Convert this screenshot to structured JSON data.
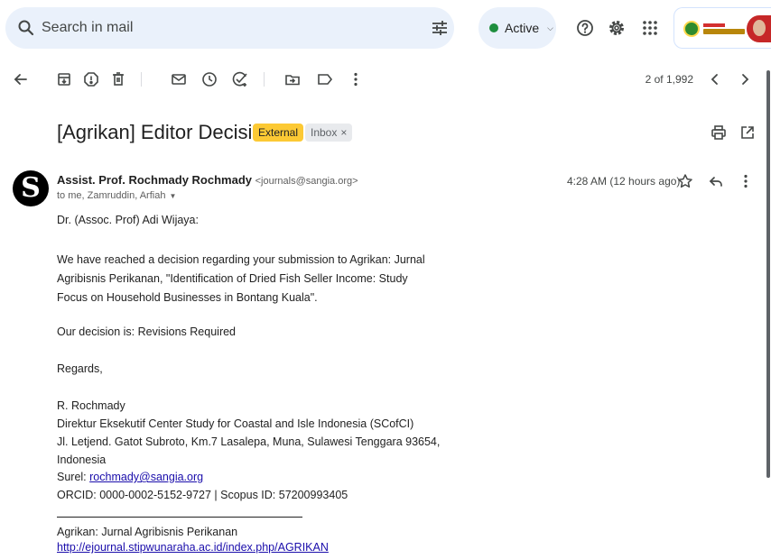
{
  "search": {
    "placeholder": "Search in mail",
    "value": ""
  },
  "status": {
    "label": "Active",
    "color": "#1e8e3e"
  },
  "pager": {
    "text": "2 of 1,992"
  },
  "email": {
    "subject": "[Agrikan] Editor Decision",
    "labels": {
      "external": "External",
      "inbox": "Inbox",
      "inbox_remove": "×"
    },
    "sender": {
      "avatar_letter": "S",
      "name": "Assist. Prof. Rochmady Rochmady",
      "email": "<journals@sangia.org>",
      "recipients": "to me, Zamruddin, Arfiah"
    },
    "timestamp": "4:28 AM (12 hours ago)",
    "body": {
      "greeting": "Dr. (Assoc. Prof) Adi Wijaya:",
      "para1": [
        "We have reached a decision regarding your submission to Agrikan: Jurnal",
        "Agribisnis Perikanan, \"Identification of Dried Fish Seller Income: Study",
        "Focus on Household Businesses in Bontang Kuala\"."
      ],
      "decision": "Our decision is: Revisions Required",
      "closing": "Regards,",
      "signature": {
        "name": "R. Rochmady",
        "title": "Direktur Eksekutif Center Study for Coastal and Isle Indonesia (SCofCI)",
        "address1": "Jl. Letjend. Gatot Subroto, Km.7 Lasalepa, Muna, Sulawesi Tenggara 93654,",
        "address2": "Indonesia",
        "email_label": "Surel: ",
        "email": "rochmady@sangia.org",
        "ids": "ORCID: 0000-0002-5152-9727 | Scopus ID: 57200993405"
      },
      "footer": {
        "journal": "Agrikan: Jurnal Agribisnis Perikanan",
        "url": "http://ejournal.stipwunaraha.ac.id/index.php/AGRIKAN"
      }
    }
  },
  "colors": {
    "search_bg": "#eaf1fb",
    "external_badge": "#fcc934",
    "inbox_badge": "#e8eaed",
    "link": "#1a0dab"
  },
  "icons": {
    "topbar": [
      "search-icon",
      "filter-icon",
      "help-icon",
      "settings-icon",
      "apps-grid-icon"
    ],
    "toolbar": [
      "back-arrow-icon",
      "archive-icon",
      "report-spam-icon",
      "delete-icon",
      "mark-unread-icon",
      "snooze-icon",
      "add-to-tasks-icon",
      "move-to-icon",
      "label-icon",
      "more-vert-icon",
      "chevron-left-icon",
      "chevron-right-icon"
    ],
    "message": [
      "print-icon",
      "open-in-new-window-icon",
      "star-icon",
      "reply-icon",
      "more-vert-icon"
    ]
  }
}
